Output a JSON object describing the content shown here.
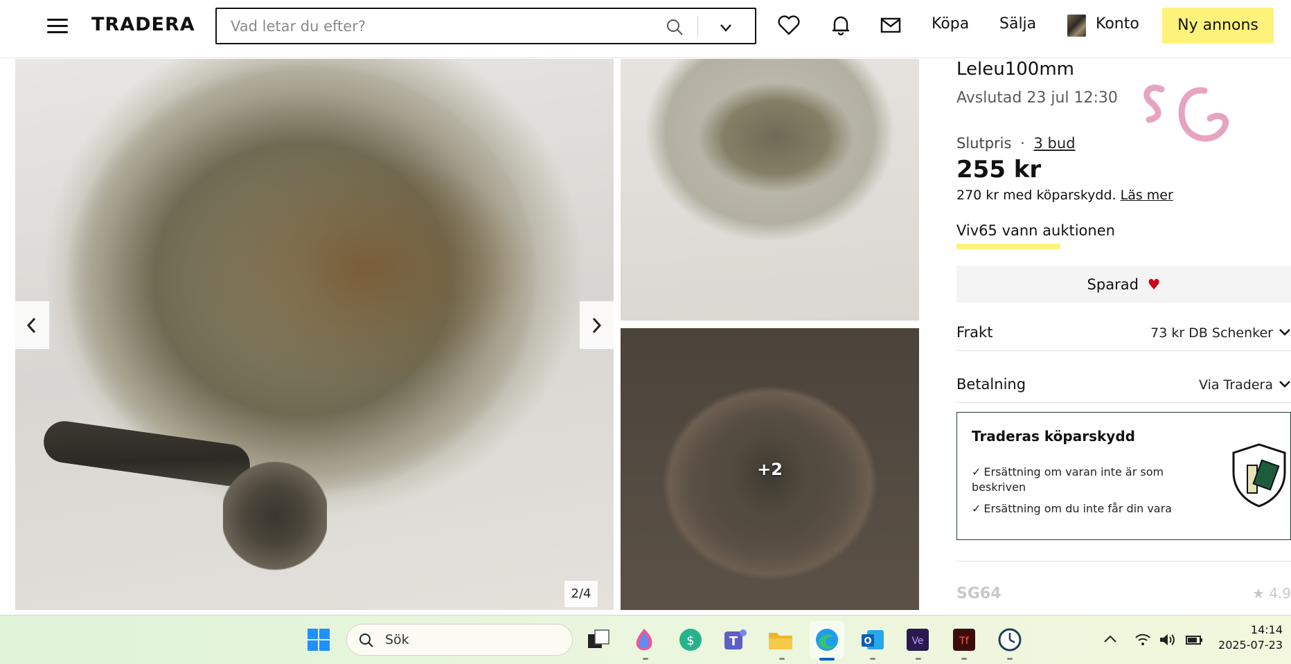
{
  "header": {
    "logo": "TRADERA",
    "search_placeholder": "Vad letar du efter?",
    "nav": {
      "buy": "Köpa",
      "sell": "Sälja",
      "account": "Konto"
    },
    "cta": "Ny annons"
  },
  "gallery": {
    "counter": "2/4",
    "more_label": "+2"
  },
  "listing": {
    "title": "Leleu100mm",
    "ended": "Avslutad 23 jul 12:30",
    "final_price_label": "Slutpris",
    "separator": "·",
    "bids": "3 bud",
    "price": "255 kr",
    "protection_price": "270 kr med köparskydd.",
    "read_more": "Läs mer",
    "winner": "Viv65 vann auktionen",
    "saved_label": "Sparad",
    "rows": [
      {
        "label": "Frakt",
        "value": "73 kr DB Schenker"
      },
      {
        "label": "Betalning",
        "value": "Via Tradera"
      }
    ],
    "protection": {
      "title": "Traderas köparskydd",
      "items": [
        "Ersättning om varan inte är som beskriven",
        "Ersättning om du inte får din vara"
      ]
    },
    "seller_partial": "SG64",
    "rating_partial": "4.9"
  },
  "taskbar": {
    "search_label": "Sök",
    "time": "14:14",
    "date": "2025-07-23"
  },
  "colors": {
    "accent_yellow": "#fff27a",
    "heart_red": "#d0021b",
    "protection_border": "#1d3b34"
  }
}
